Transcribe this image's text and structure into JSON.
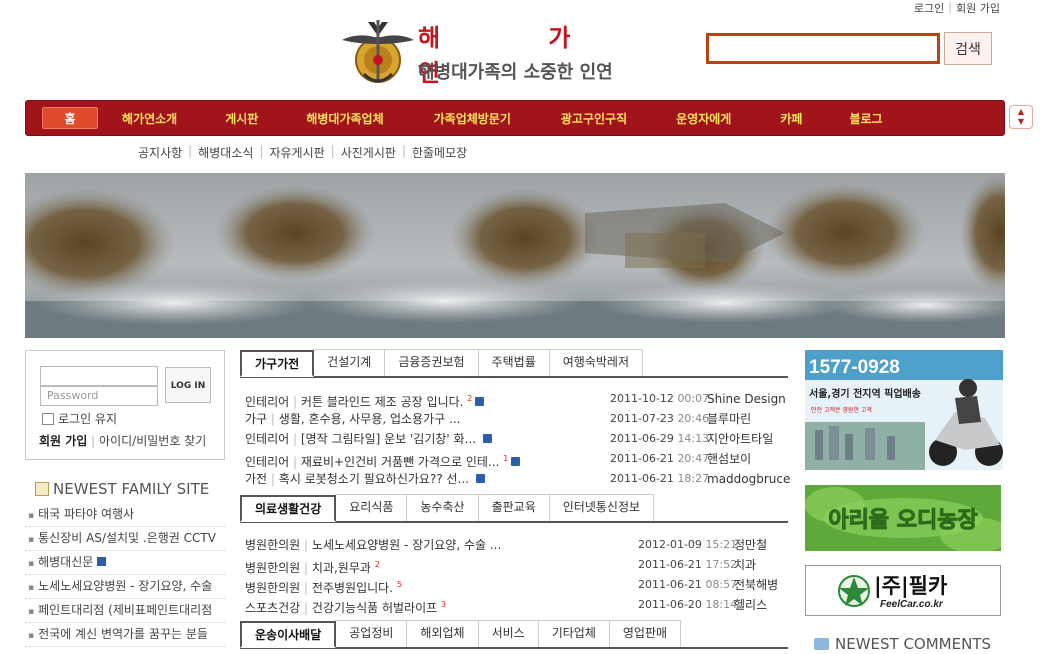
{
  "top_links": {
    "login": "로그인",
    "signup": "회원 가입"
  },
  "logo": {
    "title": "해 가 연",
    "subtitle": "해병대가족의 소중한 인연"
  },
  "search": {
    "value": "",
    "button": "검색"
  },
  "colors": {
    "nav_bg": "#a1141c",
    "nav_text": "#ffe35a",
    "home_bg": "#df4a2c",
    "accent": "#c4141d"
  },
  "nav": {
    "home": "홈",
    "items": [
      "해가연소개",
      "게시판",
      "해병대가족업체",
      "가족업체방문기",
      "광고구인구직",
      "운영자에게",
      "카페",
      "블로그"
    ]
  },
  "subnav": [
    "공지사항",
    "해병대소식",
    "자유게시판",
    "사진게시판",
    "한줄메모장"
  ],
  "login": {
    "password_placeholder": "Password",
    "button": "LOG IN",
    "keep": "로그인 유지",
    "join": "회원 가입",
    "find": "아이디/비밀번호 찾기"
  },
  "family": {
    "title": "NEWEST FAMILY SITE",
    "items": [
      "태국 파타야 여행사",
      "통신장비 AS/설치및 .은행권 CCTV",
      "해병대신문",
      "노세노세요양병원 - 장기요양, 수술",
      "페인트대리점 (제비표페인트대리점",
      "전국에 계신 변역가를 꿈꾸는 분들"
    ]
  },
  "section1": {
    "tabs": [
      "가구가전",
      "건설기계",
      "금융증권보험",
      "주택법률",
      "여행숙박레저"
    ],
    "rows": [
      {
        "cat": "인테리어",
        "title": "커튼 블라인드 제조 공장 입니다.",
        "count": "2",
        "date": "2011-10-12",
        "time": "00:07",
        "author": "Shine Design"
      },
      {
        "cat": "가구",
        "title": "생활, 혼수용, 사무용, 업소용가구 ...",
        "count": "",
        "date": "2011-07-23",
        "time": "20:46",
        "author": "블루마린"
      },
      {
        "cat": "인테리어",
        "title": "[명작 그림타일] 운보 '김기창' 화...",
        "count": "",
        "date": "2011-06-29",
        "time": "14:13",
        "author": "지안아트타일"
      },
      {
        "cat": "인테리어",
        "title": "재료비+인건비 거품뺀 가격으로 인테...",
        "count": "1",
        "date": "2011-06-21",
        "time": "20:47",
        "author": "핸섬보이"
      },
      {
        "cat": "가전",
        "title": "혹시 로봇청소기 필요하신가요?? 선...",
        "count": "",
        "date": "2011-06-21",
        "time": "18:27",
        "author": "maddogbruce"
      }
    ]
  },
  "section2": {
    "tabs": [
      "의료생활건강",
      "요리식품",
      "농수축산",
      "출판교육",
      "인터넷통신정보"
    ],
    "rows": [
      {
        "cat": "병원한의원",
        "title": "노세노세요양병원 - 장기요양, 수술 ...",
        "count": "",
        "date": "2012-01-09",
        "time": "15:21",
        "author": "정만철"
      },
      {
        "cat": "병원한의원",
        "title": "치과,원무과",
        "count": "2",
        "date": "2011-06-21",
        "time": "17:52",
        "author": "치과"
      },
      {
        "cat": "병원한의원",
        "title": "전주병원입니다.",
        "count": "5",
        "date": "2011-06-21",
        "time": "08:57",
        "author": "전북해병"
      },
      {
        "cat": "스포츠건강",
        "title": "건강기능식품 허벌라이프",
        "count": "3",
        "date": "2011-06-20",
        "time": "18:14",
        "author": "헬리스"
      }
    ]
  },
  "section3": {
    "tabs": [
      "운송이사배달",
      "공업정비",
      "해외업체",
      "서비스",
      "기타업체",
      "영업판매"
    ]
  },
  "ads": {
    "ad1_phone": "1577-0928",
    "ad1_line1": "서울,경기 전지역 픽업배송",
    "ad1_line2": "안전 고객은 영원한 고객",
    "ad2_text": "아리울 오디농장",
    "ad3_text": "|주|필카",
    "ad3_sub": "FeelCar.co.kr"
  },
  "comments": {
    "title": "NEWEST COMMENTS"
  }
}
